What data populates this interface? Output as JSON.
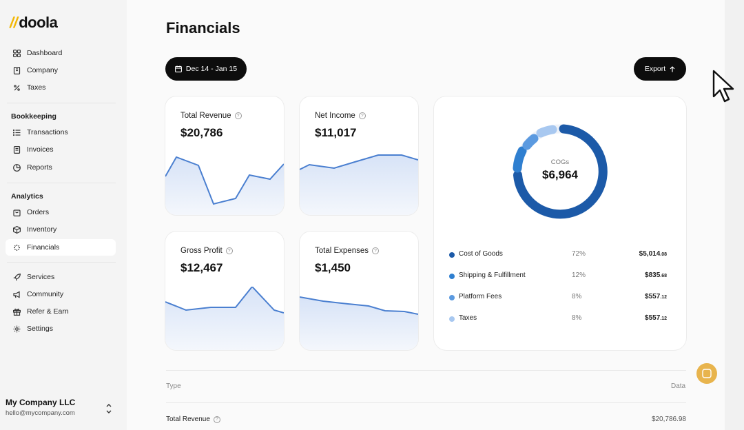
{
  "brand": {
    "slashes": "//",
    "name": "doola"
  },
  "sidebar": {
    "top_items": [
      {
        "label": "Dashboard",
        "icon": "grid-icon"
      },
      {
        "label": "Company",
        "icon": "building-icon"
      },
      {
        "label": "Taxes",
        "icon": "percent-icon"
      }
    ],
    "bookkeeping_heading": "Bookkeeping",
    "bookkeeping_items": [
      {
        "label": "Transactions",
        "icon": "list-icon"
      },
      {
        "label": "Invoices",
        "icon": "document-icon"
      },
      {
        "label": "Reports",
        "icon": "pie-icon"
      }
    ],
    "analytics_heading": "Analytics",
    "analytics_items": [
      {
        "label": "Orders",
        "icon": "bag-icon"
      },
      {
        "label": "Inventory",
        "icon": "box-icon"
      },
      {
        "label": "Financials",
        "icon": "sparkle-icon"
      }
    ],
    "bottom_items": [
      {
        "label": "Services",
        "icon": "rocket-icon"
      },
      {
        "label": "Community",
        "icon": "megaphone-icon"
      },
      {
        "label": "Refer & Earn",
        "icon": "gift-icon"
      },
      {
        "label": "Settings",
        "icon": "gear-icon"
      }
    ],
    "company_name": "My Company LLC",
    "company_email": "hello@mycompany.com"
  },
  "header": {
    "title": "Financials",
    "date_range": "Dec 14 - Jan 15",
    "export_label": "Export"
  },
  "cards": {
    "revenue": {
      "label": "Total Revenue",
      "value": "$20,786"
    },
    "net_income": {
      "label": "Net Income",
      "value": "$11,017"
    },
    "gross_profit": {
      "label": "Gross Profit",
      "value": "$12,467"
    },
    "expenses": {
      "label": "Total Expenses",
      "value": "$1,450"
    }
  },
  "cogs": {
    "label": "COGs",
    "value": "$6,964",
    "legend": [
      {
        "name": "Cost of Goods",
        "pct": "72%",
        "amt": "$5,014",
        "cents": ".08",
        "color": "#1c5aa8"
      },
      {
        "name": "Shipping & Fulfillment",
        "pct": "12%",
        "amt": "$835",
        "cents": ".68",
        "color": "#2f7fd0"
      },
      {
        "name": "Platform Fees",
        "pct": "8%",
        "amt": "$557",
        "cents": ".12",
        "color": "#5b9ae0"
      },
      {
        "name": "Taxes",
        "pct": "8%",
        "amt": "$557",
        "cents": ".12",
        "color": "#a8c8f0"
      }
    ]
  },
  "table": {
    "col_type": "Type",
    "col_data": "Data",
    "row1_label": "Total Revenue",
    "row1_value": "$20,786.98"
  },
  "colors": {
    "accent": "#1c5aa8",
    "line": "#4a7fd0",
    "logo": "#f2b705"
  }
}
